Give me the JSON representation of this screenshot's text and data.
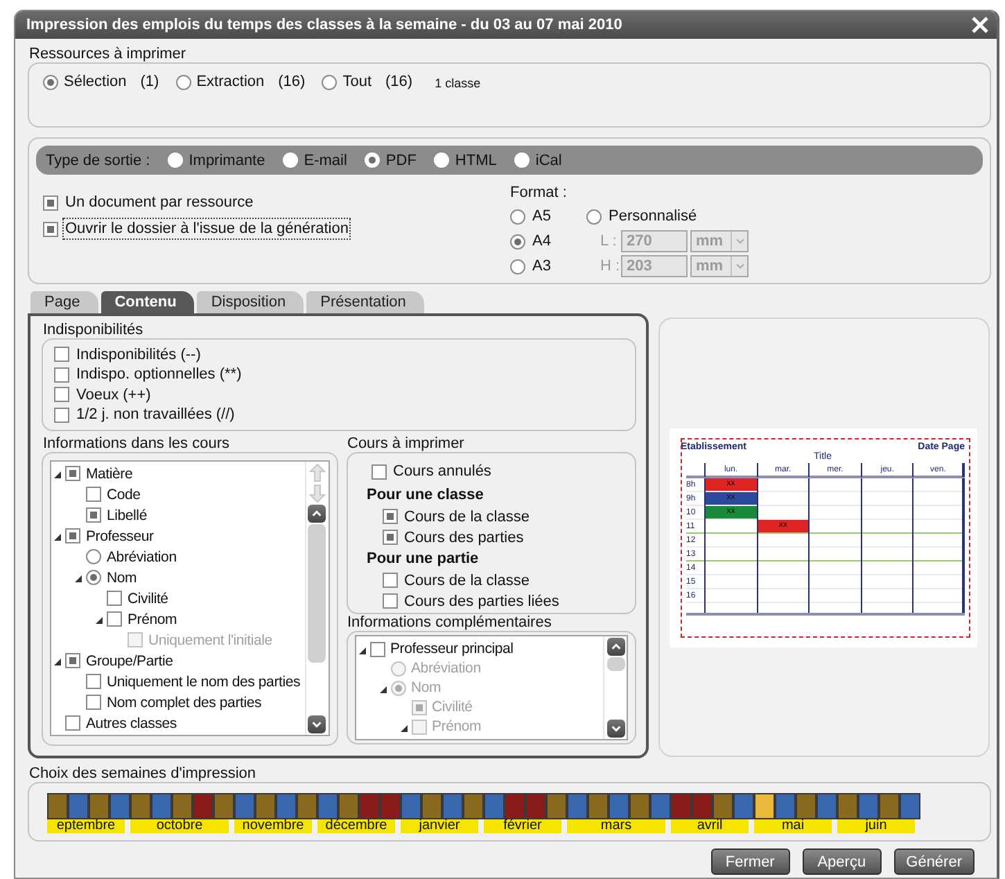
{
  "window": {
    "title": "Impression des emplois du temps des classes à la semaine - du 03 au 07 mai 2010"
  },
  "resources": {
    "legend": "Ressources à imprimer",
    "note": "1 classe",
    "options": [
      {
        "label": "Sélection",
        "count": "(1)",
        "selected": true
      },
      {
        "label": "Extraction",
        "count": "(16)",
        "selected": false
      },
      {
        "label": "Tout",
        "count": "(16)",
        "selected": false
      }
    ]
  },
  "output": {
    "label": "Type de sortie :",
    "options": [
      {
        "label": "Imprimante",
        "selected": false
      },
      {
        "label": "E-mail",
        "selected": false
      },
      {
        "label": "PDF",
        "selected": true
      },
      {
        "label": "HTML",
        "selected": false
      },
      {
        "label": "iCal",
        "selected": false
      }
    ],
    "checks": [
      {
        "label": "Un document par ressource",
        "checked": true,
        "focused": false
      },
      {
        "label": "Ouvrir le dossier à l'issue de la génération",
        "checked": true,
        "focused": true
      }
    ],
    "format": {
      "label": "Format :",
      "sizes": [
        {
          "label": "A5",
          "selected": false
        },
        {
          "label": "A4",
          "selected": true
        },
        {
          "label": "A3",
          "selected": false
        }
      ],
      "custom": {
        "label": "Personnalisé",
        "selected": false
      },
      "dims": [
        {
          "label": "L :",
          "value": "270",
          "unit": "mm",
          "disabled": true
        },
        {
          "label": "H :",
          "value": "203",
          "unit": "mm",
          "disabled": true
        }
      ]
    }
  },
  "tabs": [
    {
      "label": "Page",
      "selected": false
    },
    {
      "label": "Contenu",
      "selected": true
    },
    {
      "label": "Disposition",
      "selected": false
    },
    {
      "label": "Présentation",
      "selected": false
    }
  ],
  "unavailability": {
    "legend": "Indisponibilités",
    "items": [
      {
        "label": "Indisponibilités (--)",
        "checked": false
      },
      {
        "label": "Indispo. optionnelles (**)",
        "checked": false
      },
      {
        "label": "Voeux (++)",
        "checked": false
      },
      {
        "label": "1/2 j. non travaillées (//)",
        "checked": false
      }
    ]
  },
  "course_info": {
    "legend": "Informations dans les cours",
    "tree": [
      {
        "kind": "checkbox",
        "label": "Matière",
        "checked": true,
        "expanded": true,
        "children": [
          {
            "kind": "checkbox",
            "label": "Code",
            "checked": false
          },
          {
            "kind": "checkbox",
            "label": "Libellé",
            "checked": true
          }
        ]
      },
      {
        "kind": "checkbox",
        "label": "Professeur",
        "checked": true,
        "expanded": true,
        "children": [
          {
            "kind": "radio",
            "label": "Abréviation",
            "selected": false
          },
          {
            "kind": "radio",
            "label": "Nom",
            "selected": true,
            "expanded": true,
            "children": [
              {
                "kind": "checkbox",
                "label": "Civilité",
                "checked": false
              },
              {
                "kind": "checkbox",
                "label": "Prénom",
                "checked": false,
                "expanded": true,
                "children": [
                  {
                    "kind": "checkbox",
                    "label": "Uniquement l'initiale",
                    "checked": false,
                    "disabled": true
                  }
                ]
              }
            ]
          }
        ]
      },
      {
        "kind": "checkbox",
        "label": "Groupe/Partie",
        "checked": true,
        "expanded": true,
        "children": [
          {
            "kind": "checkbox",
            "label": "Uniquement le nom des parties",
            "checked": false
          },
          {
            "kind": "checkbox",
            "label": "Nom complet des parties",
            "checked": false
          }
        ]
      },
      {
        "kind": "checkbox",
        "label": "Autres classes",
        "checked": false
      }
    ]
  },
  "courses": {
    "legend": "Cours à imprimer",
    "items": [
      {
        "kind": "checkbox",
        "label": "Cours annulés",
        "checked": false
      },
      {
        "kind": "heading",
        "label": "Pour une classe"
      },
      {
        "kind": "checkbox",
        "label": "Cours de la classe",
        "checked": true
      },
      {
        "kind": "checkbox",
        "label": "Cours des parties",
        "checked": true
      },
      {
        "kind": "heading",
        "label": "Pour une partie"
      },
      {
        "kind": "checkbox",
        "label": "Cours de la classe",
        "checked": false
      },
      {
        "kind": "checkbox",
        "label": "Cours des parties liées",
        "checked": false
      }
    ]
  },
  "extra_info": {
    "legend": "Informations complémentaires",
    "tree": [
      {
        "kind": "checkbox",
        "label": "Professeur principal",
        "checked": false,
        "expanded": true,
        "children": [
          {
            "kind": "radio",
            "label": "Abréviation",
            "selected": false,
            "disabled": true
          },
          {
            "kind": "radio",
            "label": "Nom",
            "selected": true,
            "disabled": true,
            "expanded": true,
            "children": [
              {
                "kind": "checkbox",
                "label": "Civilité",
                "checked": true,
                "disabled": true
              },
              {
                "kind": "checkbox",
                "label": "Prénom",
                "checked": false,
                "disabled": true,
                "expanded": true
              }
            ]
          }
        ]
      }
    ]
  },
  "preview": {
    "header_left": "Etablissement",
    "header_right": "Date Page",
    "title": "Title",
    "days": [
      "lun.",
      "mar.",
      "mer.",
      "jeu.",
      "ven."
    ],
    "rows": [
      {
        "hour": "8h",
        "cells": [
          {
            "text": "xx",
            "color": "#e02424"
          },
          null,
          null,
          null,
          null
        ]
      },
      {
        "hour": "9h",
        "cells": [
          {
            "text": "xx",
            "color": "#2e4a9a"
          },
          null,
          null,
          null,
          null
        ]
      },
      {
        "hour": "10",
        "cells": [
          {
            "text": "xx",
            "color": "#1a8a3a"
          },
          null,
          null,
          null,
          null
        ]
      },
      {
        "hour": "11",
        "cells": [
          null,
          {
            "text": "xx",
            "color": "#e02424"
          },
          null,
          null,
          null
        ]
      },
      {
        "hour": "12"
      },
      {
        "hour": "13"
      },
      {
        "hour": "14"
      },
      {
        "hour": "15"
      },
      {
        "hour": "16"
      }
    ]
  },
  "weeks": {
    "legend": "Choix des semaines d'impression",
    "months": [
      {
        "label": "eptembre",
        "weeks": [
          {
            "color": "#8a6a1e"
          },
          {
            "color": "#3a68ae"
          },
          {
            "color": "#8a6a1e"
          },
          {
            "color": "#3a68ae"
          }
        ]
      },
      {
        "label": "octobre",
        "weeks": [
          {
            "color": "#8a6a1e"
          },
          {
            "color": "#3a68ae"
          },
          {
            "color": "#8a6a1e"
          },
          {
            "color": "#8b1a1a"
          },
          {
            "color": "#8a6a1e"
          }
        ]
      },
      {
        "label": "novembre",
        "weeks": [
          {
            "color": "#3a68ae"
          },
          {
            "color": "#8a6a1e"
          },
          {
            "color": "#3a68ae"
          },
          {
            "color": "#8a6a1e"
          }
        ]
      },
      {
        "label": "décembre",
        "weeks": [
          {
            "color": "#3a68ae"
          },
          {
            "color": "#8a6a1e"
          },
          {
            "color": "#8b1a1a"
          },
          {
            "color": "#8b1a1a"
          }
        ]
      },
      {
        "label": "janvier",
        "weeks": [
          {
            "color": "#3a68ae"
          },
          {
            "color": "#8a6a1e"
          },
          {
            "color": "#3a68ae"
          },
          {
            "color": "#8a6a1e"
          }
        ]
      },
      {
        "label": "février",
        "weeks": [
          {
            "color": "#3a68ae"
          },
          {
            "color": "#8b1a1a"
          },
          {
            "color": "#8b1a1a"
          },
          {
            "color": "#8a6a1e"
          }
        ]
      },
      {
        "label": "mars",
        "weeks": [
          {
            "color": "#3a68ae"
          },
          {
            "color": "#8a6a1e"
          },
          {
            "color": "#3a68ae"
          },
          {
            "color": "#8a6a1e"
          },
          {
            "color": "#3a68ae"
          }
        ]
      },
      {
        "label": "avril",
        "weeks": [
          {
            "color": "#8b1a1a"
          },
          {
            "color": "#8b1a1a"
          },
          {
            "color": "#8a6a1e"
          },
          {
            "color": "#3a68ae"
          }
        ]
      },
      {
        "label": "mai",
        "weeks": [
          {
            "color": "#eab83a"
          },
          {
            "color": "#3a68ae"
          },
          {
            "color": "#8a6a1e"
          },
          {
            "color": "#3a68ae"
          }
        ]
      },
      {
        "label": "juin",
        "weeks": [
          {
            "color": "#8a6a1e"
          },
          {
            "color": "#3a68ae"
          },
          {
            "color": "#8a6a1e"
          },
          {
            "color": "#3a68ae"
          }
        ]
      }
    ]
  },
  "buttons": [
    "Fermer",
    "Aperçu",
    "Générer"
  ]
}
